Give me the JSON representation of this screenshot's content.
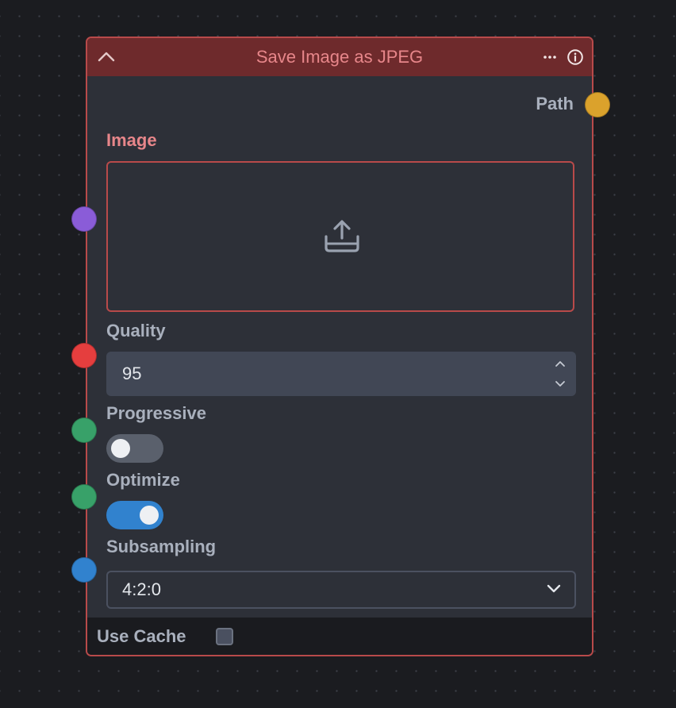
{
  "node": {
    "title": "Save Image as JPEG",
    "accent_color": "#b84a4a",
    "header_color": "#6e2a2c",
    "collapse_icon": "chevron-up-icon",
    "menu_icon": "more-horizontal-icon",
    "info_icon": "info-icon"
  },
  "output": {
    "label": "Path",
    "handle_color": "#dba22c"
  },
  "inputs": {
    "image": {
      "label": "Image",
      "handle_color": "#8a5cd8",
      "icon": "upload-icon",
      "state": "error"
    },
    "quality": {
      "label": "Quality",
      "value": "95",
      "handle_color": "#e53e3e"
    },
    "progressive": {
      "label": "Progressive",
      "checked": false,
      "handle_color": "#38a169"
    },
    "optimize": {
      "label": "Optimize",
      "checked": true,
      "handle_color": "#38a169"
    },
    "subsampling": {
      "label": "Subsampling",
      "value": "4:2:0",
      "handle_color": "#3182ce"
    }
  },
  "footer": {
    "use_cache_label": "Use Cache",
    "use_cache_checked": false
  }
}
